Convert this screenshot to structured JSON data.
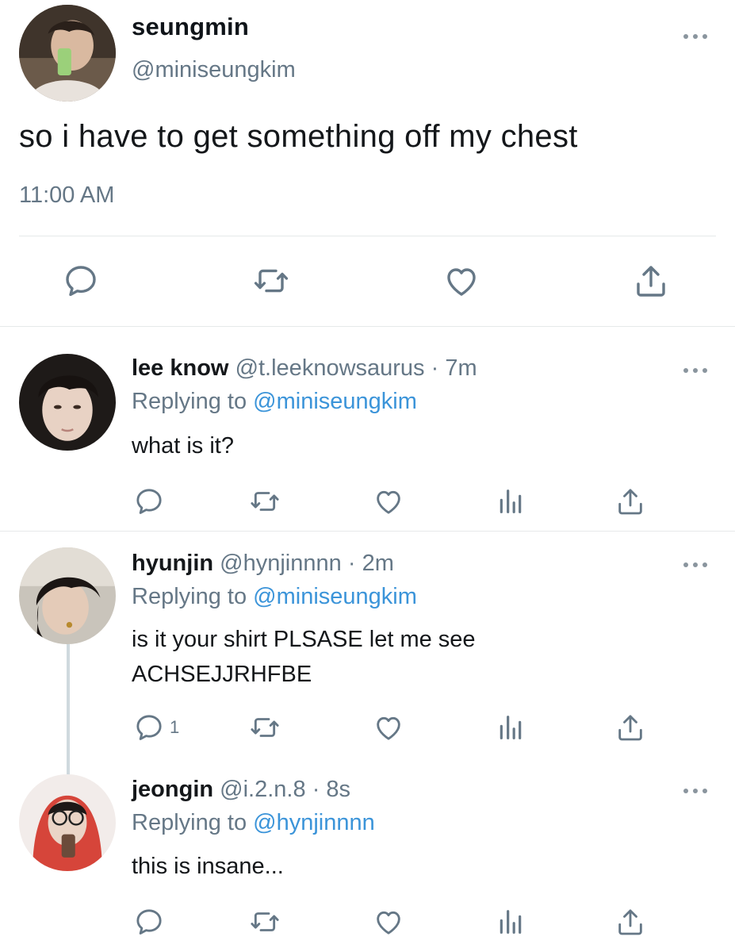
{
  "main_tweet": {
    "display_name": "seungmin",
    "handle": "@miniseungkim",
    "text": "so i have to get something off my chest",
    "time": "11:00 AM",
    "avatar": "selfie-photo"
  },
  "replies": [
    {
      "display_name": "lee know",
      "handle": "@t.leeknowsaurus",
      "separator": "·",
      "age": "7m",
      "replying_label": "Replying to",
      "replying_to": "@miniseungkim",
      "text_lines": [
        "what is it?"
      ],
      "reply_count": "",
      "avatar": "portrait-photo"
    },
    {
      "display_name": "hyunjin",
      "handle": "@hynjinnnn",
      "separator": "·",
      "age": "2m",
      "replying_label": "Replying to",
      "replying_to": "@miniseungkim",
      "text_lines": [
        "is it your shirt PLSASE let me see",
        "ACHSEJJRHFBE"
      ],
      "reply_count": "1",
      "avatar": "portrait-photo"
    },
    {
      "display_name": "jeongin",
      "handle": "@i.2.n.8",
      "separator": "·",
      "age": "8s",
      "replying_label": "Replying to",
      "replying_to": "@hynjinnnn",
      "text_lines": [
        "this is insane..."
      ],
      "reply_count": "",
      "avatar": "selfie-photo"
    }
  ],
  "icons": {
    "reply": "reply-icon",
    "retweet": "retweet-icon",
    "like": "like-icon",
    "analytics": "analytics-icon",
    "share": "share-icon",
    "more": "more-icon"
  },
  "colors": {
    "link": "#3b94d9",
    "muted": "#657786",
    "icon": "#657786",
    "divider": "#e6e9ea"
  }
}
